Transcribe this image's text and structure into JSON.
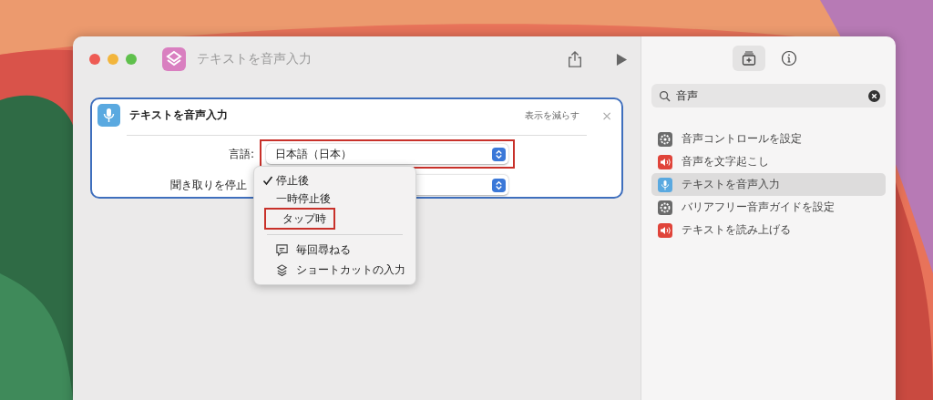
{
  "window": {
    "title": "テキストを音声入力"
  },
  "action": {
    "title": "テキストを音声入力",
    "collapse_label": "表示を減らす",
    "close": "×",
    "fields": [
      {
        "label": "言語:",
        "value": "日本語（日本）",
        "highlighted": true
      },
      {
        "label": "聞き取りを停止"
      }
    ]
  },
  "menu": {
    "items": [
      {
        "kind": "option",
        "label": "停止後",
        "checked": true,
        "highlighted": false
      },
      {
        "kind": "option",
        "label": "一時停止後",
        "checked": false,
        "highlighted": false
      },
      {
        "kind": "option",
        "label": "タップ時",
        "checked": false,
        "highlighted": true
      },
      {
        "kind": "separator"
      },
      {
        "kind": "ask",
        "label": "毎回尋ねる"
      },
      {
        "kind": "input",
        "label": "ショートカットの入力"
      }
    ]
  },
  "sidebar": {
    "tabs": [
      {
        "kind": "library",
        "selected": true
      },
      {
        "kind": "info",
        "selected": false
      }
    ],
    "search": {
      "value": "音声"
    },
    "results": [
      {
        "label": "音声コントロールを設定",
        "kind": "gear",
        "color": "#6b6b6b",
        "selected": false
      },
      {
        "label": "音声を文字起こし",
        "kind": "speaker",
        "color": "#e0443a",
        "selected": false
      },
      {
        "label": "テキストを音声入力",
        "kind": "mic",
        "color": "#5aa9e0",
        "selected": true
      },
      {
        "label": "バリアフリー音声ガイドを設定",
        "kind": "gear",
        "color": "#6b6b6b",
        "selected": false
      },
      {
        "label": "テキストを読み上げる",
        "kind": "speaker",
        "color": "#e0443a",
        "selected": false
      }
    ]
  }
}
